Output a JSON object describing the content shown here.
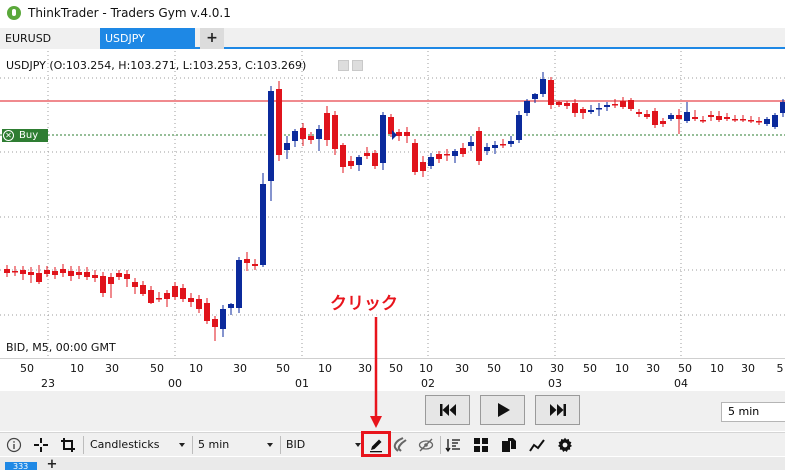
{
  "window": {
    "title": "ThinkTrader - Traders Gym v.4.0.1"
  },
  "tabs": [
    {
      "label": "EURUSD",
      "active": false
    },
    {
      "label": "USDJPY",
      "active": true
    },
    {
      "label": "+"
    }
  ],
  "chart": {
    "ohlc_label": "USDJPY (O:103.254, H:103.271, L:103.253, C:103.269)",
    "buy_label": "Buy",
    "bid_label": "BID, M5, 00:00 GMT",
    "x_ticks": [
      "50",
      "10",
      "30",
      "50",
      "10",
      "30",
      "50",
      "10",
      "30",
      "50",
      "10",
      "30",
      "50",
      "10",
      "30",
      "50",
      "10",
      "30",
      "50",
      "10",
      "30",
      "50",
      "10",
      "30",
      "50",
      "10",
      "30",
      "5"
    ],
    "x_days": [
      "23",
      "00",
      "01",
      "02",
      "03",
      "04"
    ],
    "colors": {
      "bull": "#0b2a9c",
      "bear": "#e0141c",
      "resistance": "#e0141c",
      "buy_line": "#2e7d32",
      "grid": "#9e9e9e"
    }
  },
  "playback": {
    "buttons": [
      "skip-back",
      "play",
      "skip-forward"
    ],
    "speed": "5 min"
  },
  "toolbar": {
    "chart_type": "Candlesticks",
    "timeframe": "5 min",
    "price_type": "BID",
    "icons": [
      "info-icon",
      "crosshair-icon",
      "crop-icon",
      "pencil-icon",
      "magnet-icon",
      "hide-icon",
      "sort-icon",
      "grid-icon",
      "copy-icon",
      "indicator-icon",
      "gear-icon"
    ]
  },
  "bottom_tabs": [
    {
      "label": "333"
    },
    {
      "label": "+"
    }
  ],
  "annotation": {
    "text": "クリック",
    "color": "#e8141c"
  }
}
